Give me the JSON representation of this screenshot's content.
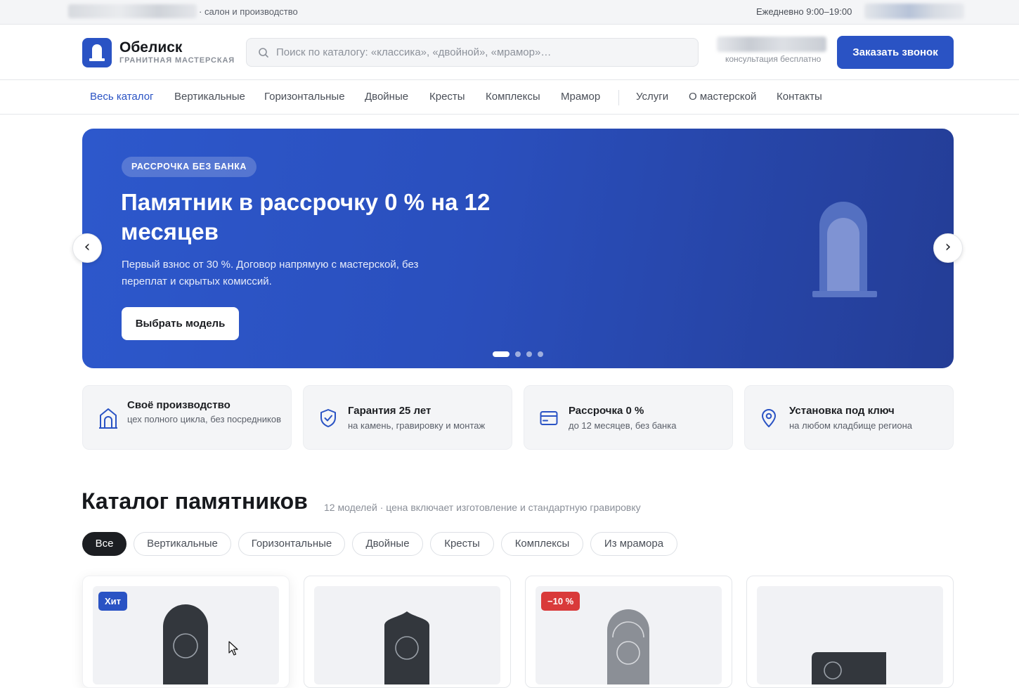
{
  "topbar": {
    "tagline": "· салон и производство",
    "hours": "Ежедневно 9:00–19:00"
  },
  "header": {
    "brand": "Обелиск",
    "brand_sub": "ГРАНИТНАЯ МАСТЕРСКАЯ",
    "search_placeholder": "Поиск по каталогу: «классика», «двойной», «мрамор»…",
    "phone_note": "консультация бесплатно",
    "cta_label": "Заказать звонок"
  },
  "nav": {
    "items": [
      "Весь каталог",
      "Вертикальные",
      "Горизонтальные",
      "Двойные",
      "Кресты",
      "Комплексы",
      "Мрамор",
      "Услуги",
      "О мастерской",
      "Контакты"
    ]
  },
  "hero": {
    "badge": "РАССРОЧКА БЕЗ БАНКА",
    "title": "Памятник в рассрочку 0 % на 12 месяцев",
    "text": "Первый взнос от 30 %. Договор напрямую с мастерской, без переплат и скрытых комиссий.",
    "button": "Выбрать модель",
    "prev": "‹",
    "next": "›",
    "slides_total": 4,
    "active_slide": 1
  },
  "features": [
    {
      "title": "Своё производство",
      "text": "цех полного цикла, без посредников",
      "icon": "factory-icon"
    },
    {
      "title": "Гарантия 25 лет",
      "text": "на камень, гравировку и монтаж",
      "icon": "shield-check-icon"
    },
    {
      "title": "Рассрочка 0 %",
      "text": "до 12 месяцев, без банка",
      "icon": "credit-card-icon"
    },
    {
      "title": "Установка под ключ",
      "text": "на любом кладбище региона",
      "icon": "map-pin-icon"
    }
  ],
  "catalog": {
    "title": "Каталог памятников",
    "subtitle": "12 моделей · цена включает изготовление и стандартную гравировку",
    "filters": [
      "Все",
      "Вертикальные",
      "Горизонтальные",
      "Двойные",
      "Кресты",
      "Комплексы",
      "Из мрамора"
    ],
    "active_filter": "Все",
    "badges": {
      "hit": "Хит",
      "discount": "−10 %"
    }
  },
  "colors": {
    "accent": "#2a53c4",
    "hit_badge": "#2a53c4",
    "discount_badge": "#d93a3a",
    "granite": "#33373d"
  }
}
